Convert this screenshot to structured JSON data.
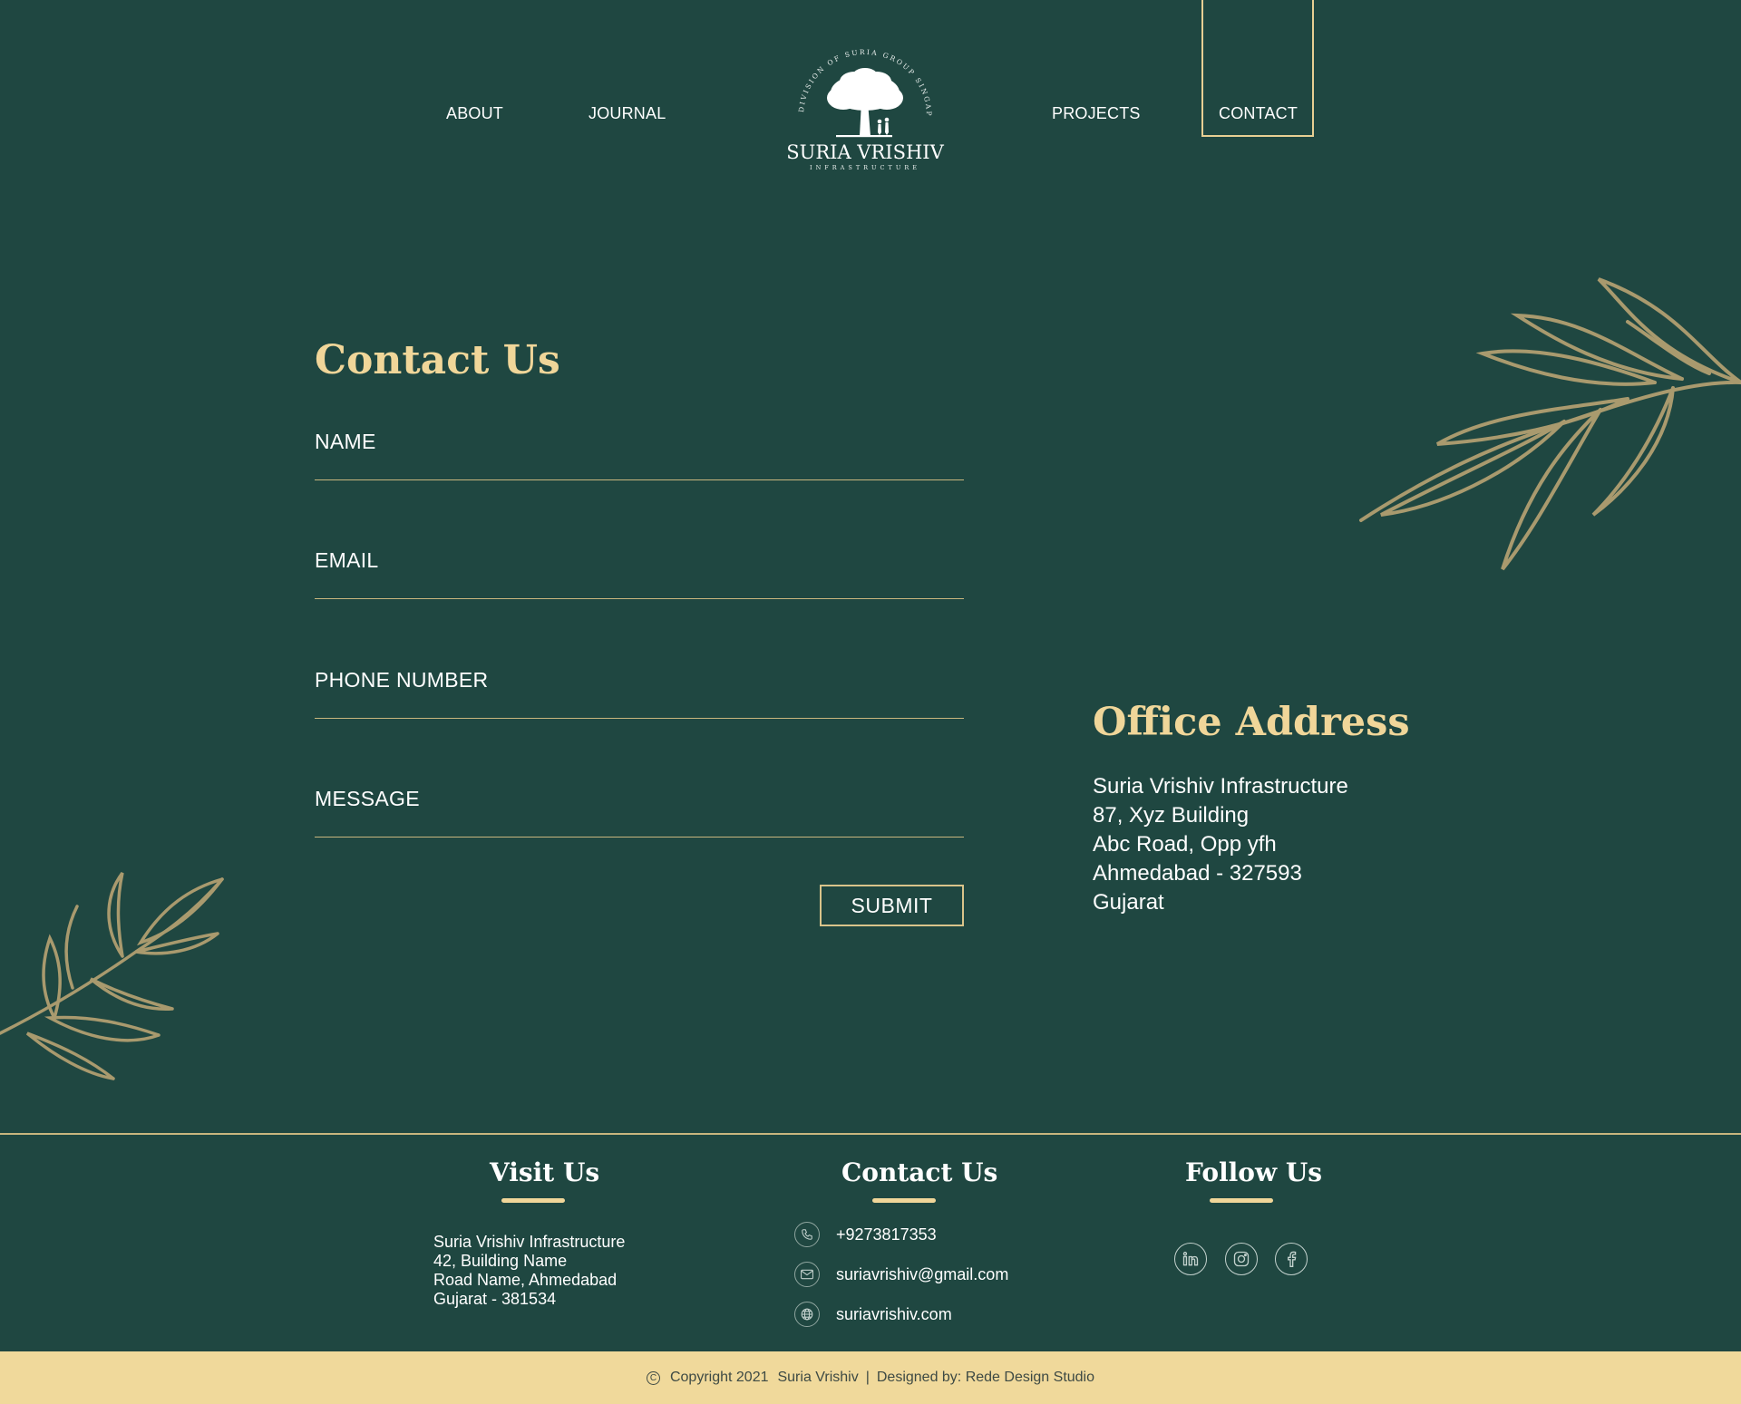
{
  "header": {
    "nav_left": [
      {
        "label": "ABOUT"
      },
      {
        "label": "JOURNAL"
      }
    ],
    "nav_right": [
      {
        "label": "PROJECTS"
      },
      {
        "label": "CONTACT",
        "active": true
      }
    ],
    "logo": {
      "arc_text": "DIVISION OF SURIA GROUP SINGAPORE",
      "name": "SURIA VRISHIV",
      "subtitle": "INFRASTRUCTURE",
      "icon": "tree-logo-icon"
    }
  },
  "contact_form": {
    "title": "Contact Us",
    "fields": {
      "name": "NAME",
      "email": "EMAIL",
      "phone": "PHONE NUMBER",
      "message": "MESSAGE"
    },
    "submit_label": "SUBMIT"
  },
  "office": {
    "title": "Office Address",
    "lines": [
      "Suria Vrishiv Infrastructure",
      "87, Xyz Building",
      "Abc Road, Opp yfh",
      "Ahmedabad - 327593",
      "Gujarat"
    ]
  },
  "footer": {
    "visit": {
      "heading": "Visit Us",
      "lines": [
        "Suria Vrishiv Infrastructure",
        "42, Building Name",
        "Road Name, Ahmedabad",
        "Gujarat - 381534"
      ]
    },
    "contact": {
      "heading": "Contact Us",
      "phone": "+9273817353",
      "email": "suriavrishiv@gmail.com",
      "website": "suriavrishiv.com"
    },
    "follow": {
      "heading": "Follow Us",
      "icons": [
        "linkedin-icon",
        "instagram-icon",
        "facebook-icon"
      ]
    },
    "copyright": {
      "year_text": "Copyright 2021",
      "brand": "Suria Vrishiv",
      "separator": "|",
      "designer": "Designed by: Rede Design Studio"
    }
  },
  "colors": {
    "background": "#1f4741",
    "accent_gold": "#f0d699",
    "line_gold": "#c8b67e",
    "leaf": "#a99a6e",
    "copyright_bar": "#f0d99b"
  }
}
